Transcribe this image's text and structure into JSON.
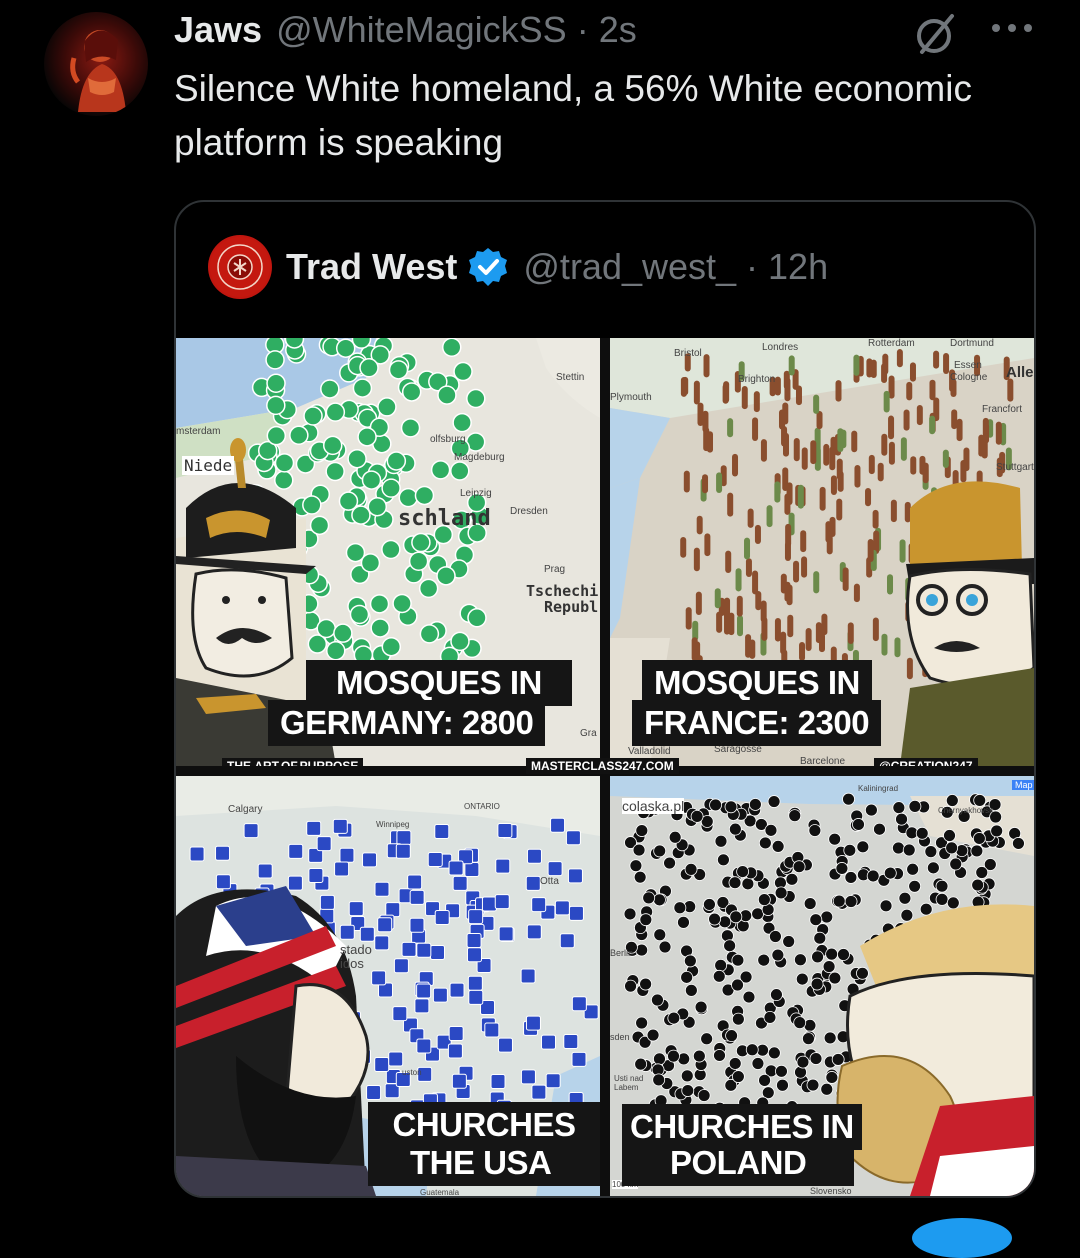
{
  "tweet": {
    "author_name": "Jaws",
    "author_handle": "@WhiteMagickSS · 2s",
    "text": "Silence White homeland, a 56% White economic platform is speaking"
  },
  "quote": {
    "author_name": "Trad West",
    "author_handle": "@trad_west_ · 12h",
    "verified": true
  },
  "meme": {
    "panels": [
      {
        "caption_lines": [
          "MOSQUES IN",
          "GERMANY: 2800"
        ],
        "map_labels": [
          "msterdam",
          "Niede",
          "schland",
          "olfsburg",
          "Magdeburg",
          "Leipzig",
          "Dresden",
          "Stettin",
          "Prag",
          "Tschechi",
          "Republ",
          "Gra"
        ]
      },
      {
        "caption_lines": [
          "MOSQUES IN",
          "FRANCE: 2300"
        ],
        "map_labels": [
          "Londres",
          "Bristol",
          "Brighton",
          "Plymouth",
          "Rotterdam",
          "Dortmund",
          "Essen",
          "Cologne",
          "Alle",
          "Francfort",
          "Stuttgart",
          "Saragosse",
          "Valladolid",
          "Barcelone"
        ]
      },
      {
        "caption_lines": [
          "CHURCHES IN",
          "THE USA"
        ],
        "map_labels": [
          "Calgary",
          "ONTARIO",
          "Winnipeg",
          "stado",
          "idos",
          "Otta",
          "uston",
          "Guatemala"
        ]
      },
      {
        "caption_lines": [
          "CHURCHES IN",
          "POLAND"
        ],
        "map_labels": [
          "colaska.pl",
          "Kaliningrad",
          "Chernyakhovsk",
          "Map",
          "Berlin",
          "sden",
          "Usti nad Labem",
          "Slovensko",
          "100 km"
        ]
      }
    ],
    "credits": [
      "THE.ART.OF.PURPOSE",
      "MASTERCLASS247.COM",
      "@CREATION247"
    ]
  },
  "colors": {
    "background": "#000000",
    "text_primary": "#e7e9ea",
    "text_secondary": "#71767b",
    "border": "#2f3336",
    "verified_blue": "#1d9bf0",
    "mosque_green": "#2fae62",
    "church_blue": "#2b49c4",
    "caption_bg": "#151515"
  },
  "icons": [
    "grok-icon",
    "more-icon",
    "verified-icon"
  ]
}
